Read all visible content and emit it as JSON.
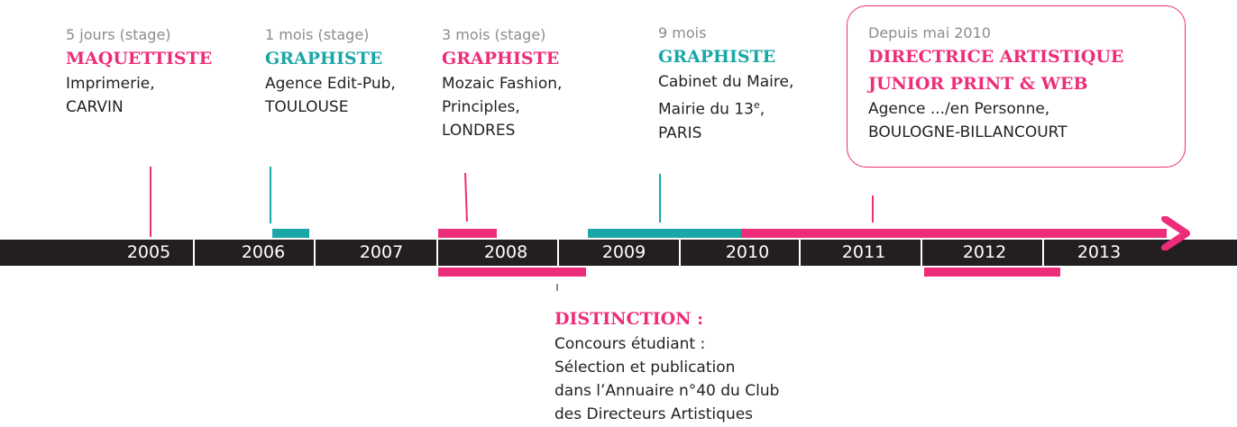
{
  "colors": {
    "pink": "#ee2d7a",
    "teal": "#1aa7a7",
    "bar": "#231f20",
    "muted": "#8c8c8c"
  },
  "timeline": {
    "years": [
      "2005",
      "2006",
      "2007",
      "2008",
      "2009",
      "2010",
      "2011",
      "2012",
      "2013"
    ]
  },
  "entries": [
    {
      "duration": "5 jours (stage)",
      "title": "MAQUETTISTE",
      "color": "pink",
      "lines": [
        "Imprimerie,",
        "CARVIN"
      ]
    },
    {
      "duration": "1 mois (stage)",
      "title": "GRAPHISTE",
      "color": "teal",
      "lines": [
        "Agence Edit-Pub,",
        "TOULOUSE"
      ]
    },
    {
      "duration": "3 mois (stage)",
      "title": "GRAPHISTE",
      "color": "pink",
      "lines": [
        "Mozaic Fashion,",
        "Principles,",
        "LONDRES"
      ]
    },
    {
      "duration": "9 mois",
      "title": "GRAPHISTE",
      "color": "teal",
      "lines": [
        "Cabinet du Maire,",
        "Mairie du 13",
        "PARIS"
      ],
      "superscript": "e",
      "after_superscript": ","
    },
    {
      "duration": "Depuis mai 2010",
      "title": "DIRECTRICE ARTISTIQUE",
      "title2": "JUNIOR PRINT & WEB",
      "color": "pink",
      "lines": [
        "Agence .../en Personne,",
        "BOULOGNE-BILLANCOURT"
      ]
    }
  ],
  "distinction": {
    "title": "DISTINCTION :",
    "lines": [
      "Concours étudiant :",
      "Sélection et publication",
      "dans l’Annuaire n°40 du Club",
      "des Directeurs Artistiques"
    ]
  }
}
